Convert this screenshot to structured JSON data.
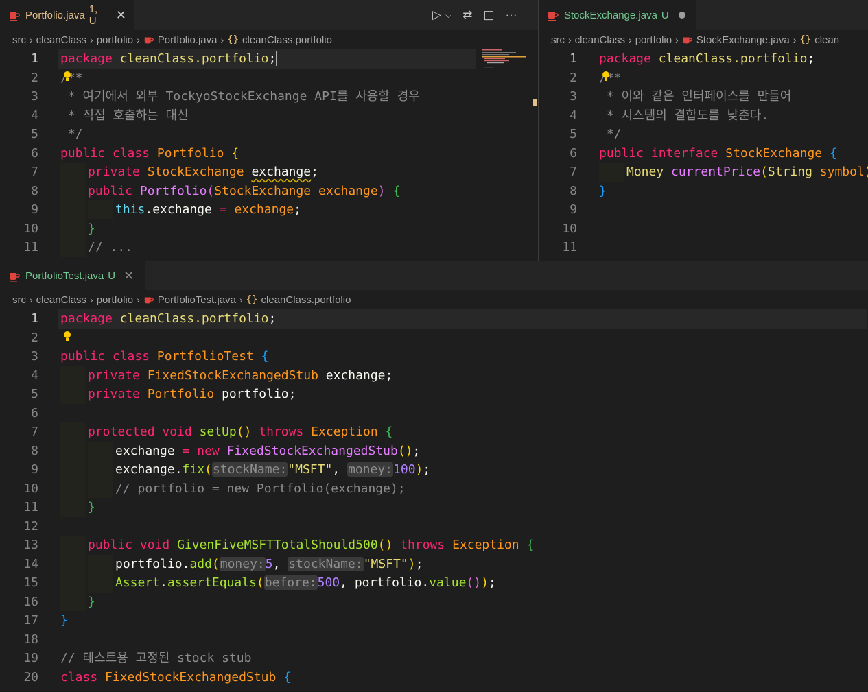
{
  "panes": {
    "portfolio": {
      "tab": {
        "name": "Portfolio.java",
        "status": "1, U"
      },
      "breadcrumb": [
        "src",
        "cleanClass",
        "portfolio",
        "Portfolio.java",
        "cleanClass.portfolio"
      ],
      "lines": [
        {
          "n": "1"
        },
        {
          "n": "2"
        },
        {
          "n": "3"
        },
        {
          "n": "4"
        },
        {
          "n": "5"
        },
        {
          "n": "6"
        },
        {
          "n": "7"
        },
        {
          "n": "8"
        },
        {
          "n": "9"
        },
        {
          "n": "10"
        },
        {
          "n": "11"
        }
      ],
      "code": {
        "l1_kw": "package",
        "l1_pkg": "cleanClass.portfolio",
        "l2": "/**",
        "l3": " * 여기에서 외부 TockyoStockExchange API를 사용할 경우",
        "l4": " * 직접 호출하는 대신",
        "l5": " */",
        "l6_kw": "public class",
        "l6_name": "Portfolio",
        "l7_kw": "private",
        "l7_type": "StockExchange",
        "l7_field": "exchange",
        "l8_kw": "public",
        "l8_name": "Portfolio",
        "l8_type": "StockExchange",
        "l8_param": "exchange",
        "l9_this": "this",
        "l9_field": "exchange",
        "l9_val": "exchange",
        "l11": "// ..."
      }
    },
    "stockexchange": {
      "tab": {
        "name": "StockExchange.java",
        "status": "U"
      },
      "breadcrumb": [
        "src",
        "cleanClass",
        "portfolio",
        "StockExchange.java",
        "clean"
      ],
      "lines": [
        {
          "n": "1"
        },
        {
          "n": "2"
        },
        {
          "n": "3"
        },
        {
          "n": "4"
        },
        {
          "n": "5"
        },
        {
          "n": "6"
        },
        {
          "n": "7"
        },
        {
          "n": "8"
        },
        {
          "n": "9"
        },
        {
          "n": "10"
        },
        {
          "n": "11"
        }
      ],
      "code": {
        "l1_kw": "package",
        "l1_pkg": "cleanClass.portfolio",
        "l2": "/**",
        "l3": " * 이와 같은 인터페이스를 만들어",
        "l4": " * 시스템의 결합도를 낮춘다.",
        "l5": " */",
        "l6_kw": "public interface",
        "l6_name": "StockExchange",
        "l7_type": "Money",
        "l7_fn": "currentPrice",
        "l7_ptype": "String",
        "l7_param": "symbol"
      }
    },
    "portfoliotest": {
      "tab": {
        "name": "PortfolioTest.java",
        "status": "U"
      },
      "breadcrumb": [
        "src",
        "cleanClass",
        "portfolio",
        "PortfolioTest.java",
        "cleanClass.portfolio"
      ],
      "lines": [
        {
          "n": "1"
        },
        {
          "n": "2"
        },
        {
          "n": "3"
        },
        {
          "n": "4"
        },
        {
          "n": "5"
        },
        {
          "n": "6"
        },
        {
          "n": "7"
        },
        {
          "n": "8"
        },
        {
          "n": "9"
        },
        {
          "n": "10"
        },
        {
          "n": "11"
        },
        {
          "n": "12"
        },
        {
          "n": "13"
        },
        {
          "n": "14"
        },
        {
          "n": "15"
        },
        {
          "n": "16"
        },
        {
          "n": "17"
        },
        {
          "n": "18"
        },
        {
          "n": "19"
        },
        {
          "n": "20"
        }
      ],
      "code": {
        "l1_kw": "package",
        "l1_pkg": "cleanClass.portfolio",
        "l3_kw": "public class",
        "l3_name": "PortfolioTest",
        "l4_kw": "private",
        "l4_type": "FixedStockExchangedStub",
        "l4_field": "exchange",
        "l5_kw": "private",
        "l5_type": "Portfolio",
        "l5_field": "portfolio",
        "l7_kw": "protected void",
        "l7_fn": "setUp",
        "l7_throws": "throws",
        "l7_exc": "Exception",
        "l8_var": "exchange",
        "l8_new": "new",
        "l8_type": "FixedStockExchangedStub",
        "l9_var": "exchange",
        "l9_fn": "fix",
        "l9_hint1": "stockName:",
        "l9_str": "\"MSFT\"",
        "l9_hint2": "money:",
        "l9_num": "100",
        "l10": "// portfolio = new Portfolio(exchange);",
        "l13_kw": "public void",
        "l13_fn": "GivenFiveMSFTTotalShould500",
        "l13_throws": "throws",
        "l13_exc": "Exception",
        "l14_var": "portfolio",
        "l14_fn": "add",
        "l14_hint1": "money:",
        "l14_num": "5",
        "l14_hint2": "stockName:",
        "l14_str": "\"MSFT\"",
        "l15_cls": "Assert",
        "l15_fn": "assertEquals",
        "l15_hint": "before:",
        "l15_num": "500",
        "l15_var": "portfolio",
        "l15_fn2": "value",
        "l19": "// 테스트용 고정된 stock stub",
        "l20_kw": "class",
        "l20_name": "FixedStockExchangedStub"
      }
    }
  },
  "colors": {
    "accent_modified": "#e2c08d",
    "accent_untracked": "#73c991",
    "background": "#1e1e1e"
  },
  "icons": {
    "tab_file": "java-coffee-icon",
    "lightbulb": "lightbulb-icon",
    "run": "run-icon",
    "split": "split-editor-icon",
    "more": "more-actions-icon"
  }
}
